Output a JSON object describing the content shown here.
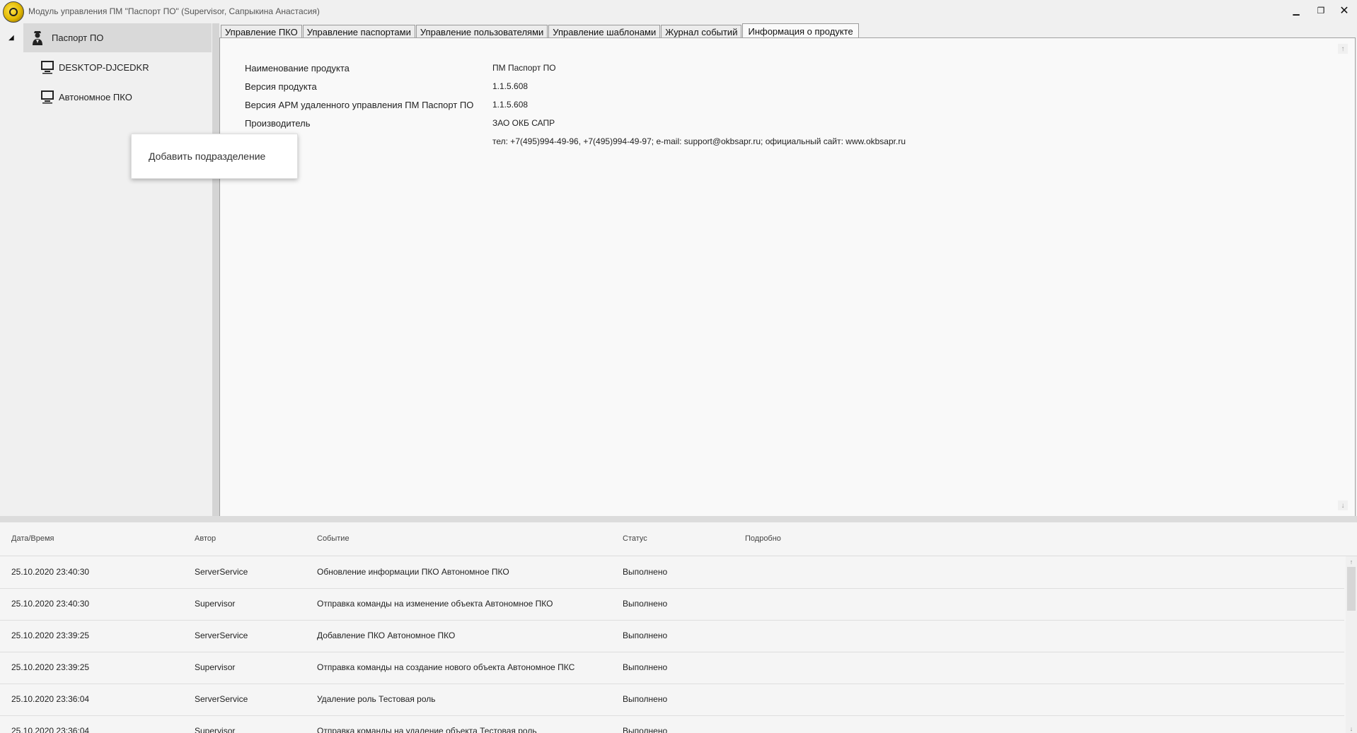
{
  "window": {
    "title": "Модуль управления ПМ \"Паспорт ПО\" (Supervisor, Сапрыкина Анастасия)",
    "min_icon": "▁",
    "max_icon": "❐",
    "close_icon": "✕"
  },
  "tree": {
    "toggle": "◢",
    "root_label": "Паспорт ПО",
    "children": [
      {
        "label": "DESKTOP-DJCEDKR"
      },
      {
        "label": "Автономное ПКО"
      }
    ]
  },
  "context_menu": {
    "items": [
      "Добавить подразделение"
    ]
  },
  "tabs": [
    {
      "label": "Управление ПКО"
    },
    {
      "label": "Управление паспортами"
    },
    {
      "label": "Управление пользователями"
    },
    {
      "label": "Управление шаблонами"
    },
    {
      "label": "Журнал событий"
    },
    {
      "label": "Информация о продукте"
    }
  ],
  "active_tab": "Информация о продукте",
  "product_info": [
    {
      "label": "Наименование продукта",
      "value": "ПМ Паспорт ПО"
    },
    {
      "label": "Версия продукта",
      "value": "1.1.5.608"
    },
    {
      "label": "Версия АРМ удаленного управления ПМ Паспорт ПО",
      "value": "1.1.5.608"
    },
    {
      "label": "Производитель",
      "value": "ЗАО ОКБ САПР"
    },
    {
      "label": "",
      "value": "тел: +7(495)994-49-96, +7(495)994-49-97; e-mail: support@okbsapr.ru; официальный сайт: www.okbsapr.ru"
    }
  ],
  "events": {
    "columns": [
      "Дата/Время",
      "Автор",
      "Событие",
      "Статус",
      "Подробно"
    ],
    "rows": [
      {
        "datetime": "25.10.2020 23:40:30",
        "author": "ServerService",
        "event": "Обновление информации  ПКО Автономное ПКО",
        "status": "Выполнено",
        "details": ""
      },
      {
        "datetime": "25.10.2020 23:40:30",
        "author": "Supervisor",
        "event": "Отправка команды на изменение объекта  Автономное ПКО",
        "status": "Выполнено",
        "details": ""
      },
      {
        "datetime": "25.10.2020 23:39:25",
        "author": "ServerService",
        "event": "Добавление ПКО Автономное ПКО",
        "status": "Выполнено",
        "details": ""
      },
      {
        "datetime": "25.10.2020 23:39:25",
        "author": "Supervisor",
        "event": "Отправка команды на создание нового объекта  Автономное ПКС",
        "status": "Выполнено",
        "details": ""
      },
      {
        "datetime": "25.10.2020 23:36:04",
        "author": "ServerService",
        "event": "Удаление роль Тестовая роль",
        "status": "Выполнено",
        "details": ""
      },
      {
        "datetime": "25.10.2020 23:36:04",
        "author": "Supervisor",
        "event": "Отправка команды на удаление объекта  Тестовая роль",
        "status": "Выполнено",
        "details": ""
      }
    ]
  },
  "colors": {
    "active_tree_bg": "#d9d9d9",
    "panel_bg": "#f9f9f9",
    "window_bg": "#f0f0f0"
  }
}
